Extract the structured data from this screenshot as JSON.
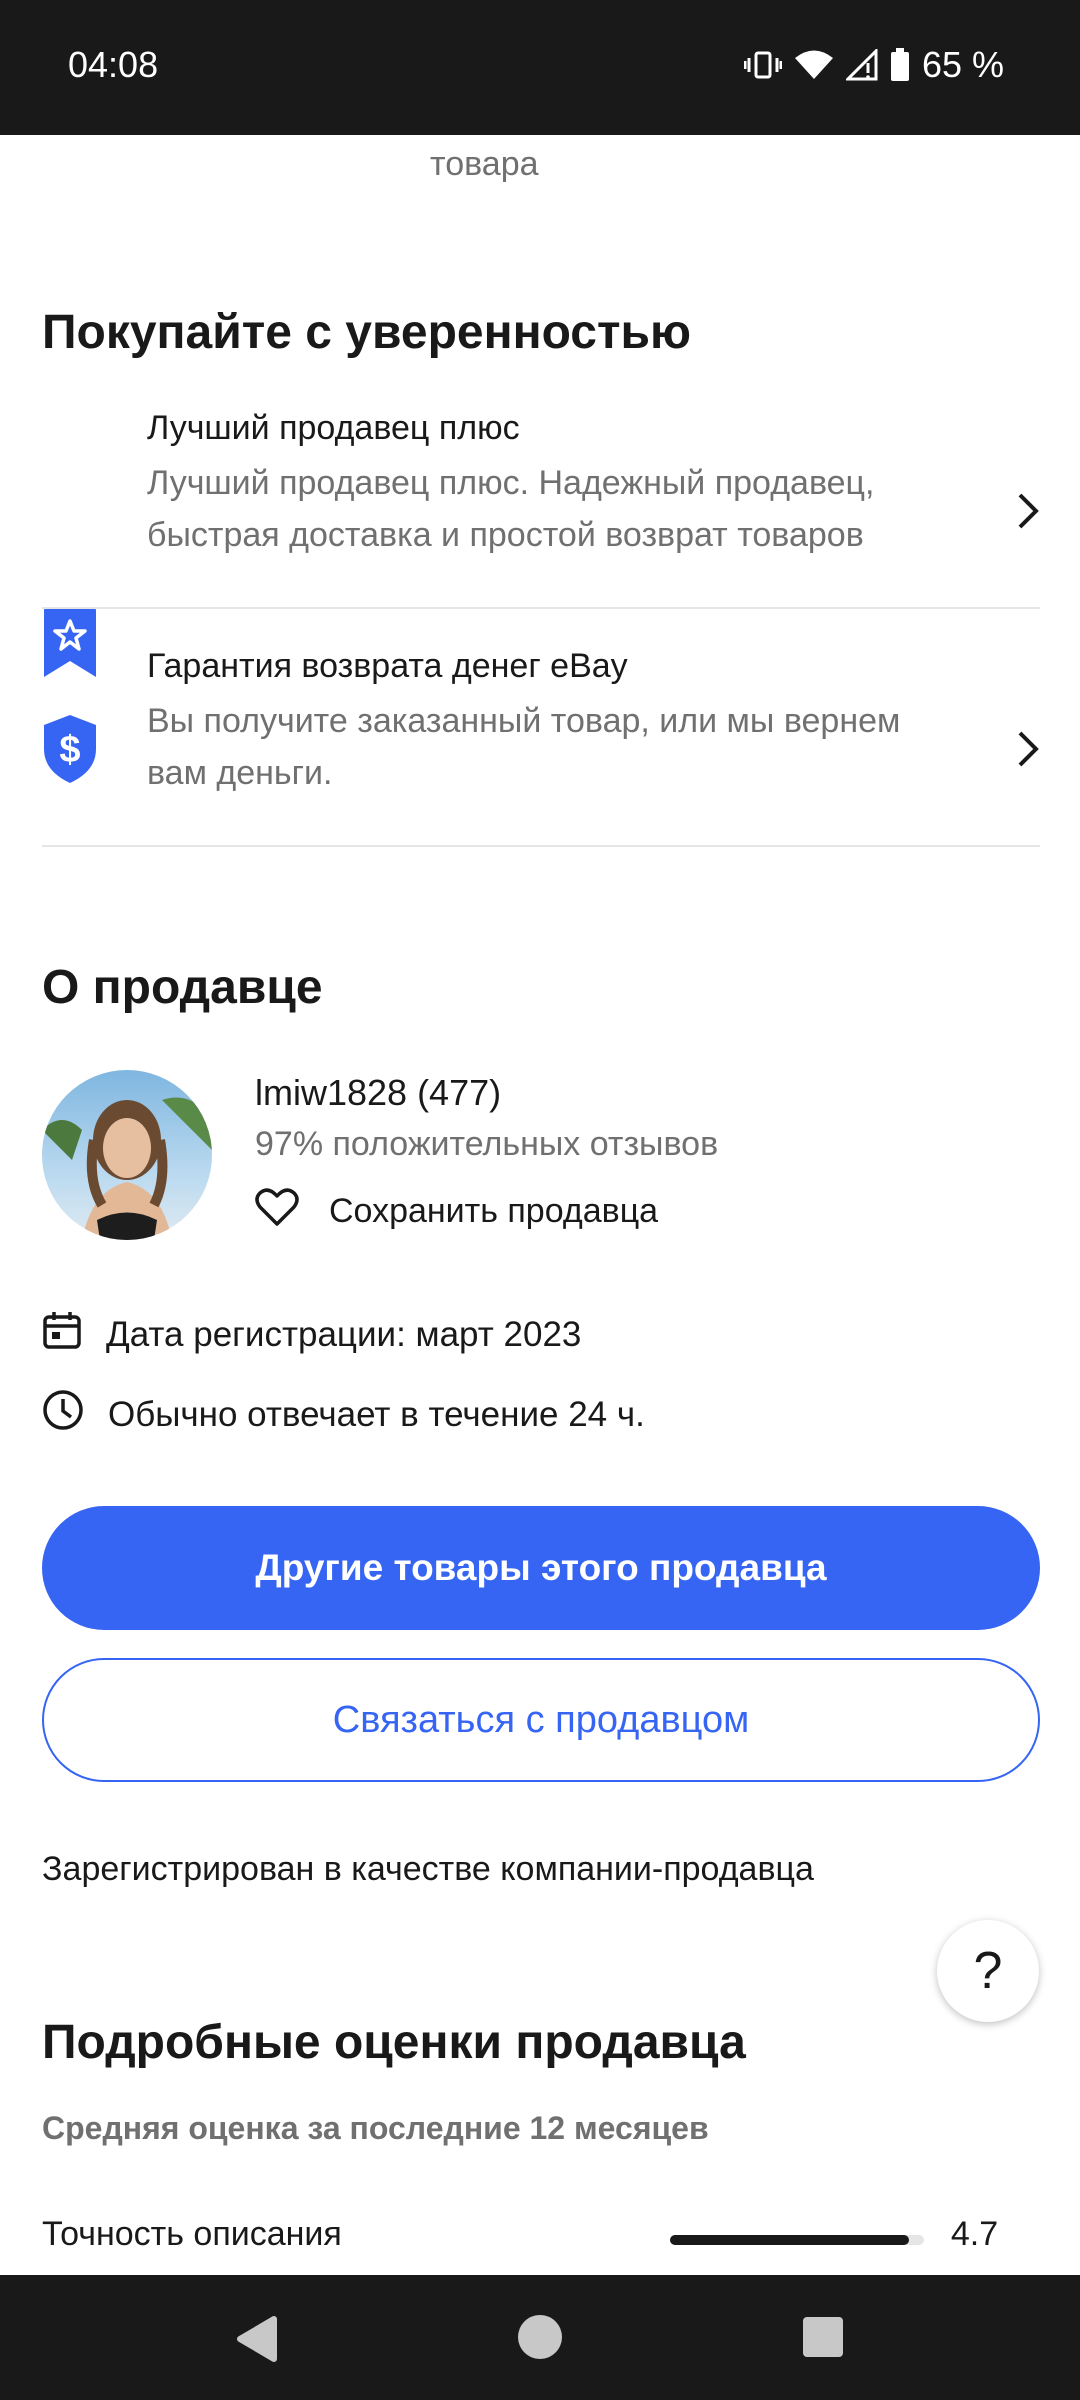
{
  "status_bar": {
    "time": "04:08",
    "battery": "65 %",
    "icons": [
      "vibrate-icon",
      "wifi-icon",
      "signal-icon",
      "battery-icon"
    ]
  },
  "top_cut_text": "товара",
  "buy_with_confidence": {
    "title": "Покупайте с уверенностью",
    "items": [
      {
        "icon": "top-rated-seller-icon",
        "title": "Лучший продавец плюс",
        "description": "Лучший продавец плюс. Надежный продавец, быстрая доставка и простой возврат товаров"
      },
      {
        "icon": "money-back-guarantee-icon",
        "title": "Гарантия возврата денег eBay",
        "description": "Вы получите заказанный товар, или мы вернем вам деньги."
      }
    ]
  },
  "about_seller": {
    "title": "О продавце",
    "seller_name": "lmiw1828 (477)",
    "feedback": "97% положительных отзывов",
    "save_label": "Сохранить продавца",
    "registration": "Дата регистрации: март 2023",
    "response_time": "Обычно отвечает в течение 24 ч.",
    "other_items_button": "Другие товары этого продавца",
    "contact_button": "Связаться с продавцом",
    "registered_as": "Зарегистрирован в качестве компании-продавца"
  },
  "help_button": "?",
  "detailed_ratings": {
    "title": "Подробные оценки продавца",
    "subtitle": "Средняя оценка за последние 12 месяцев",
    "items": [
      {
        "label": "Точность описания",
        "value": "4.7",
        "fraction": 0.94
      }
    ]
  },
  "colors": {
    "accent": "#3665f3",
    "text_primary": "#191919",
    "text_secondary": "#707070",
    "divider": "#e5e5e5",
    "system_bar": "#191919"
  }
}
